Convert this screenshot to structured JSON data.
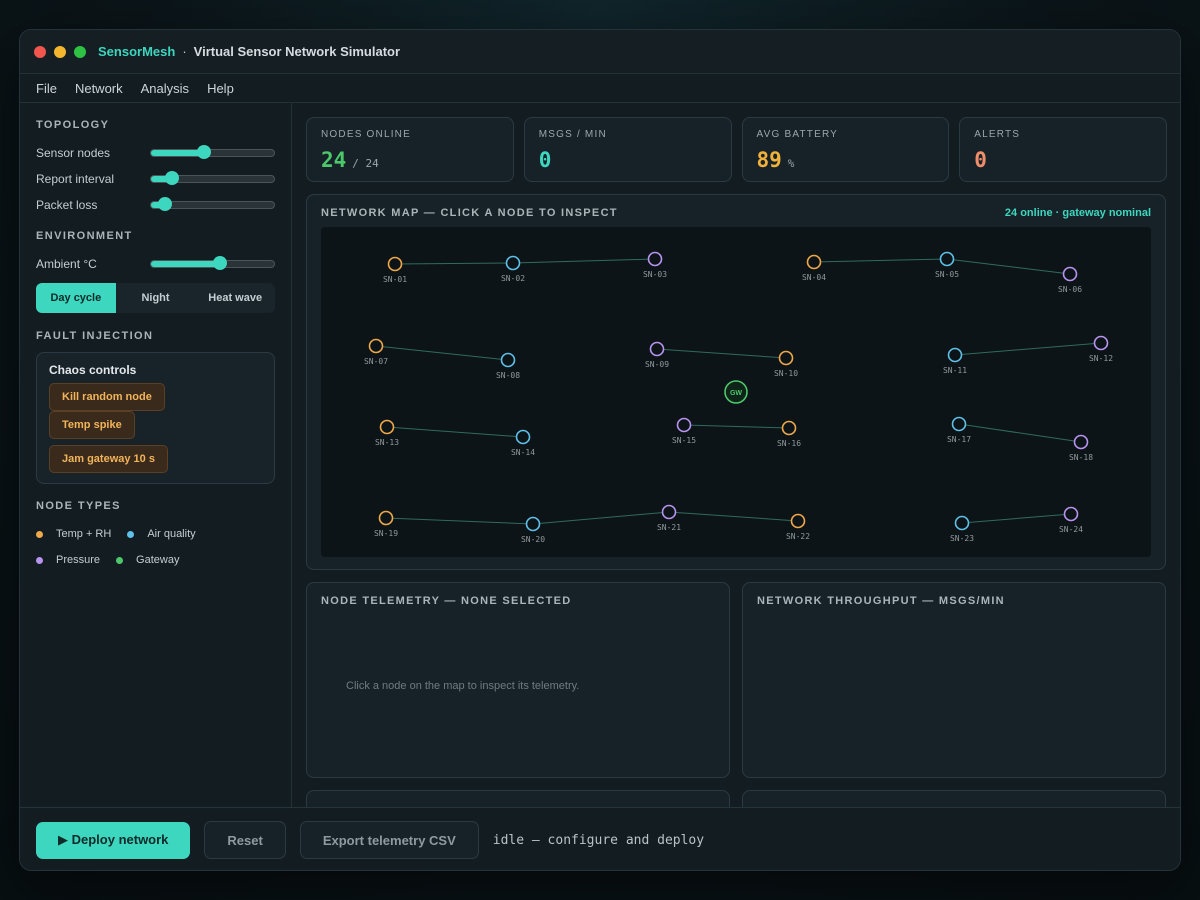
{
  "window": {
    "app_name": "SensorMesh",
    "separator": "·",
    "subtitle": "Virtual Sensor Network Simulator"
  },
  "menu": [
    "File",
    "Network",
    "Analysis",
    "Help"
  ],
  "sidebar": {
    "topology_title": "TOPOLOGY",
    "topology_sliders": [
      {
        "label": "Sensor nodes",
        "value": 0.43
      },
      {
        "label": "Report interval",
        "value": 0.17
      },
      {
        "label": "Packet loss",
        "value": 0.12
      }
    ],
    "environment_title": "ENVIRONMENT",
    "ambient": {
      "label": "Ambient °C",
      "value": 0.56
    },
    "modes": [
      {
        "label": "Day cycle",
        "active": true
      },
      {
        "label": "Night",
        "active": false
      },
      {
        "label": "Heat wave",
        "active": false
      }
    ],
    "fault_title": "FAULT INJECTION",
    "chaos_title": "Chaos controls",
    "chaos_buttons": [
      "Kill random node",
      "Temp spike",
      "Jam gateway 10 s"
    ],
    "node_types_title": "NODE TYPES",
    "node_types": [
      {
        "label": "Temp + RH",
        "color": "#f0a94a"
      },
      {
        "label": "Air quality",
        "color": "#5fc0ea"
      },
      {
        "label": "Pressure",
        "color": "#b894f0"
      },
      {
        "label": "Gateway",
        "color": "#4cc76a"
      }
    ]
  },
  "stats": [
    {
      "label": "NODES ONLINE",
      "value": "24",
      "suffix": "/ 24",
      "color": "#4cc76a"
    },
    {
      "label": "MSGS / MIN",
      "value": "0",
      "suffix": "",
      "color": "#3dd6bf"
    },
    {
      "label": "AVG BATTERY",
      "value": "89",
      "suffix": "%",
      "color": "#f0b23a"
    },
    {
      "label": "ALERTS",
      "value": "0",
      "suffix": "",
      "color": "#f08d6a"
    }
  ],
  "map": {
    "title": "NETWORK MAP — CLICK A NODE TO INSPECT",
    "status": "24 online · gateway nominal",
    "gateway_label": "GW",
    "nodes": [
      {
        "id": "SN-01",
        "type": "temp"
      },
      {
        "id": "SN-02",
        "type": "air"
      },
      {
        "id": "SN-03",
        "type": "pressure"
      },
      {
        "id": "SN-04",
        "type": "temp"
      },
      {
        "id": "SN-05",
        "type": "air"
      },
      {
        "id": "SN-06",
        "type": "pressure"
      },
      {
        "id": "SN-07",
        "type": "temp"
      },
      {
        "id": "SN-08",
        "type": "air"
      },
      {
        "id": "SN-09",
        "type": "pressure"
      },
      {
        "id": "SN-10",
        "type": "temp"
      },
      {
        "id": "SN-11",
        "type": "air"
      },
      {
        "id": "SN-12",
        "type": "pressure"
      },
      {
        "id": "SN-13",
        "type": "temp"
      },
      {
        "id": "SN-14",
        "type": "air"
      },
      {
        "id": "SN-15",
        "type": "pressure"
      },
      {
        "id": "SN-16",
        "type": "temp"
      },
      {
        "id": "SN-17",
        "type": "air"
      },
      {
        "id": "SN-18",
        "type": "pressure"
      },
      {
        "id": "SN-19",
        "type": "temp"
      },
      {
        "id": "SN-20",
        "type": "air"
      },
      {
        "id": "SN-21",
        "type": "pressure"
      },
      {
        "id": "SN-22",
        "type": "temp"
      },
      {
        "id": "SN-23",
        "type": "air"
      },
      {
        "id": "SN-24",
        "type": "pressure"
      }
    ],
    "links": [
      [
        "SN-01",
        "SN-02"
      ],
      [
        "SN-02",
        "SN-03"
      ],
      [
        "SN-04",
        "SN-05"
      ],
      [
        "SN-05",
        "SN-06"
      ],
      [
        "SN-07",
        "SN-08"
      ],
      [
        "SN-09",
        "SN-10"
      ],
      [
        "SN-11",
        "SN-12"
      ],
      [
        "SN-13",
        "SN-14"
      ],
      [
        "SN-15",
        "SN-16"
      ],
      [
        "SN-17",
        "SN-18"
      ],
      [
        "SN-19",
        "SN-20"
      ],
      [
        "SN-20",
        "SN-21"
      ],
      [
        "SN-21",
        "SN-22"
      ],
      [
        "SN-23",
        "SN-24"
      ]
    ],
    "colors": {
      "temp": "#f0a94a",
      "air": "#5fc0ea",
      "pressure": "#b894f0",
      "gateway": "#4cc76a",
      "link": "#2f6b5e"
    }
  },
  "telemetry": {
    "title": "NODE TELEMETRY — NONE SELECTED",
    "empty": "Click a node on the map to inspect its telemetry."
  },
  "throughput": {
    "title": "NETWORK THROUGHPUT — MSGS/MIN"
  },
  "footer": {
    "deploy": "▶ Deploy network",
    "reset": "Reset",
    "export": "Export telemetry CSV",
    "status": "idle — configure and deploy"
  }
}
